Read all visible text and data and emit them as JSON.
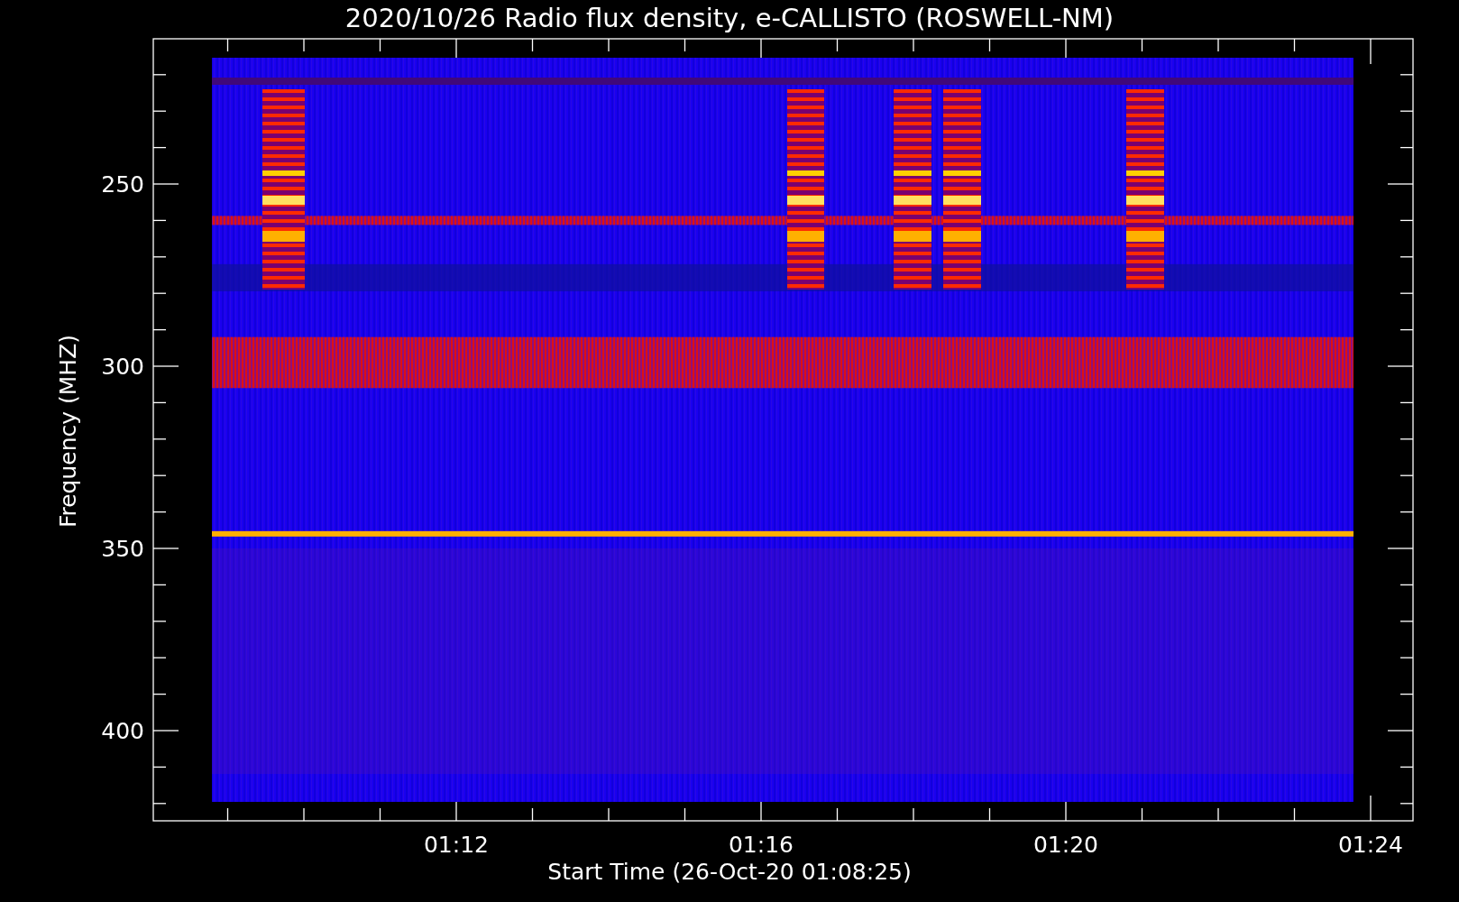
{
  "title": "2020/10/26  Radio flux density, e-CALLISTO (ROSWELL-NM)",
  "y_axis": {
    "label": "Frequency (MHZ)",
    "ticks": [
      "250",
      "300",
      "350",
      "400"
    ]
  },
  "x_axis": {
    "label": "Start Time (26-Oct-20 01:08:25)",
    "ticks": [
      "01:12",
      "01:16",
      "01:20",
      "01:24"
    ]
  }
}
